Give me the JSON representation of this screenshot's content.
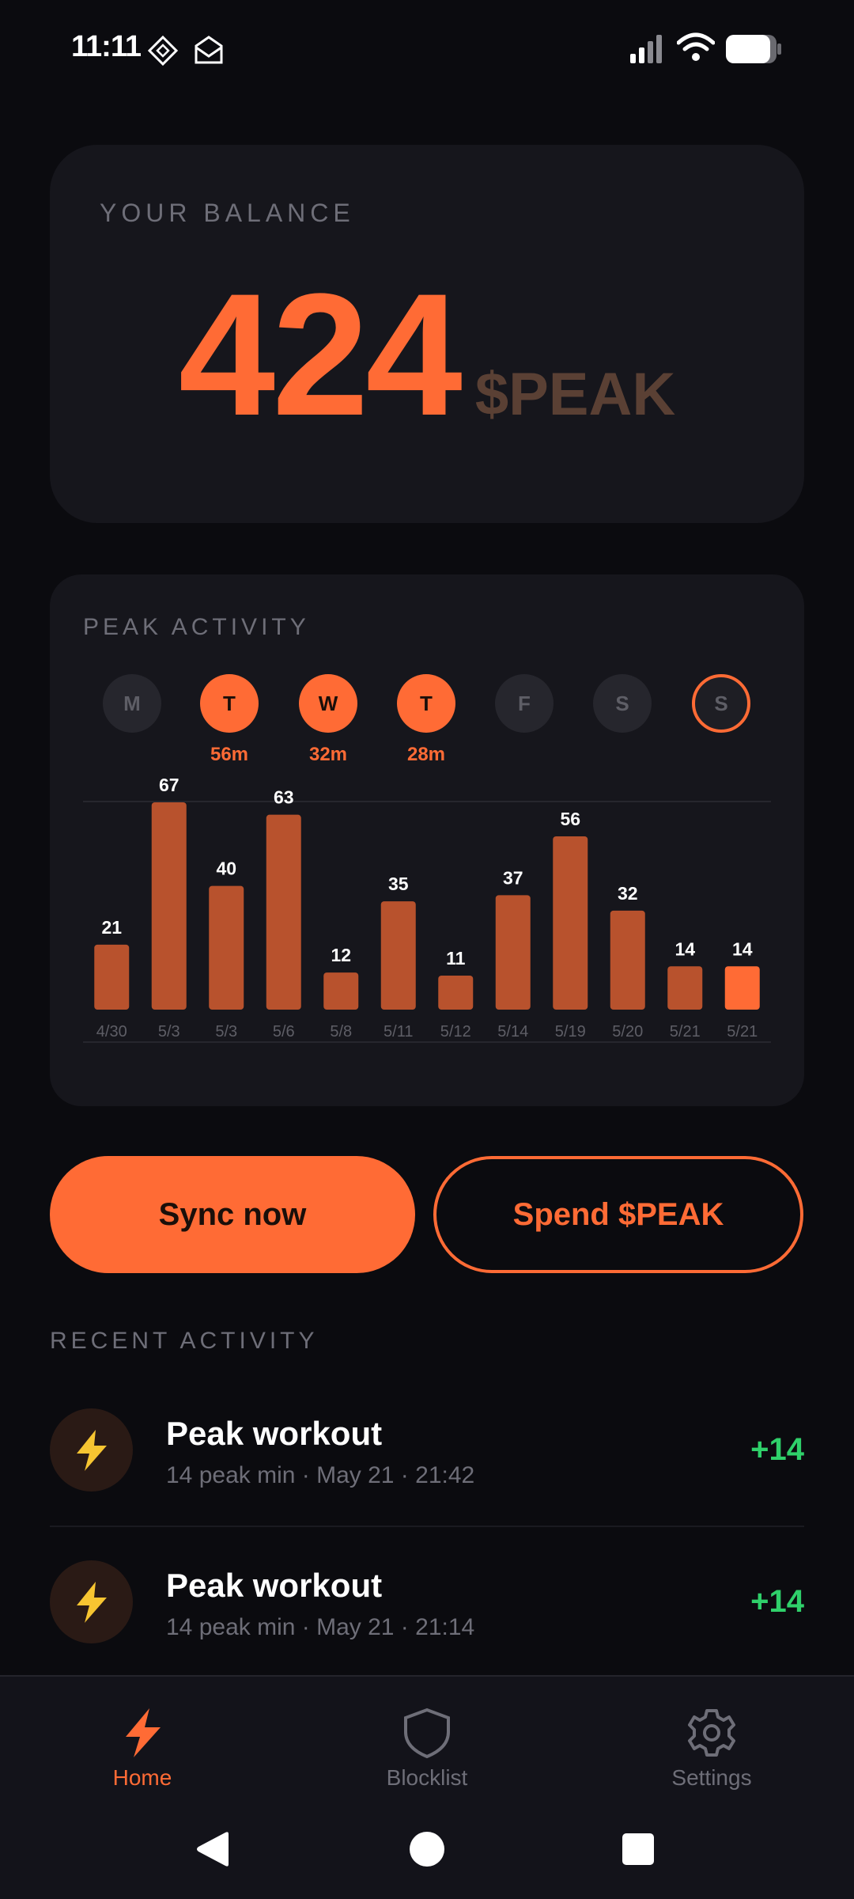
{
  "status_bar": {
    "time": "11:11"
  },
  "balance": {
    "label": "YOUR BALANCE",
    "value": "424",
    "unit": "$PEAK"
  },
  "activity": {
    "label": "PEAK ACTIVITY",
    "days": [
      {
        "letter": "M",
        "state": "inactive",
        "minutes": ""
      },
      {
        "letter": "T",
        "state": "active",
        "minutes": "56m"
      },
      {
        "letter": "W",
        "state": "active",
        "minutes": "32m"
      },
      {
        "letter": "T",
        "state": "active",
        "minutes": "28m"
      },
      {
        "letter": "F",
        "state": "inactive",
        "minutes": ""
      },
      {
        "letter": "S",
        "state": "inactive",
        "minutes": ""
      },
      {
        "letter": "S",
        "state": "today",
        "minutes": ""
      }
    ]
  },
  "chart_data": {
    "type": "bar",
    "categories": [
      "4/30",
      "5/3",
      "5/3",
      "5/6",
      "5/8",
      "5/11",
      "5/12",
      "5/14",
      "5/19",
      "5/20",
      "5/21",
      "5/21"
    ],
    "values": [
      21,
      67,
      40,
      63,
      12,
      35,
      11,
      37,
      56,
      32,
      14,
      14
    ],
    "highlight_index": 11,
    "ylim": [
      0,
      67
    ],
    "colors": {
      "bar": "#b8522d",
      "highlight": "#ff6b35",
      "label": "#ffffff",
      "tick": "#5e5e66"
    }
  },
  "actions": {
    "sync_label": "Sync now",
    "spend_label": "Spend $PEAK"
  },
  "recent": {
    "label": "RECENT ACTIVITY",
    "items": [
      {
        "title": "Peak workout",
        "subtitle": "14 peak min · May 21 · 21:42",
        "delta": "+14",
        "icon": "lightning-icon"
      },
      {
        "title": "Peak workout",
        "subtitle": "14 peak min · May 21 · 21:14",
        "delta": "+14",
        "icon": "lightning-icon"
      }
    ]
  },
  "nav": {
    "items": [
      {
        "label": "Home",
        "icon": "lightning-icon",
        "active": true
      },
      {
        "label": "Blocklist",
        "icon": "shield-icon",
        "active": false
      },
      {
        "label": "Settings",
        "icon": "gear-icon",
        "active": false
      }
    ]
  },
  "colors": {
    "accent": "#ff6b35",
    "background": "#0b0b0f",
    "card": "#16161c",
    "positive": "#2fd06a"
  }
}
